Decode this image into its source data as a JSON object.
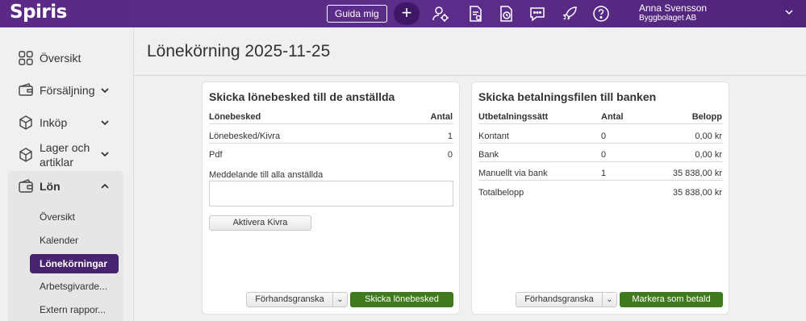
{
  "app": {
    "logo": "Spiris"
  },
  "topbar": {
    "guide_label": "Guida mig",
    "plus_label": "+",
    "icons": [
      "user-settings-icon",
      "document-settings-icon",
      "clock-document-icon",
      "chat-icon",
      "rocket-icon",
      "help-icon"
    ],
    "user_name": "Anna Svensson",
    "company": "Byggbolaget AB"
  },
  "sidebar": {
    "items": [
      {
        "label": "Översikt",
        "icon": "grid-icon"
      },
      {
        "label": "Försäljning",
        "icon": "wallet-icon"
      },
      {
        "label": "Inköp",
        "icon": "box-icon"
      },
      {
        "label": "Lager och artiklar",
        "icon": "box-icon"
      },
      {
        "label": "Lön",
        "icon": "payroll-wallet-icon"
      }
    ],
    "lon_sub": [
      {
        "label": "Översikt"
      },
      {
        "label": "Kalender"
      },
      {
        "label": "Lönekörningar"
      },
      {
        "label": "Arbetsgivarde..."
      },
      {
        "label": "Extern rappor..."
      }
    ]
  },
  "page": {
    "title": "Lönekörning 2025-11-25"
  },
  "payslip_card": {
    "title": "Skicka lönebesked till de anställda",
    "col_name": "Lönebesked",
    "col_count": "Antal",
    "rows": [
      {
        "name": "Lönebesked/Kivra",
        "count": "1"
      },
      {
        "name": "Pdf",
        "count": "0"
      }
    ],
    "message_label": "Meddelande till alla anställda",
    "activate_label": "Aktivera Kivra",
    "preview_label": "Förhandsgranska",
    "send_label": "Skicka lönebesked"
  },
  "bank_card": {
    "title": "Skicka betalningsfilen till banken",
    "col_method": "Utbetalningssätt",
    "col_count": "Antal",
    "col_amount": "Belopp",
    "rows": [
      {
        "method": "Kontant",
        "count": "0",
        "amount": "0,00 kr"
      },
      {
        "method": "Bank",
        "count": "0",
        "amount": "0,00 kr"
      },
      {
        "method": "Manuellt via bank",
        "count": "1",
        "amount": "35 838,00 kr"
      }
    ],
    "total_label": "Totalbelopp",
    "total_amount": "35 838,00 kr",
    "preview_label": "Förhandsgranska",
    "mark_paid_label": "Markera som betald"
  }
}
